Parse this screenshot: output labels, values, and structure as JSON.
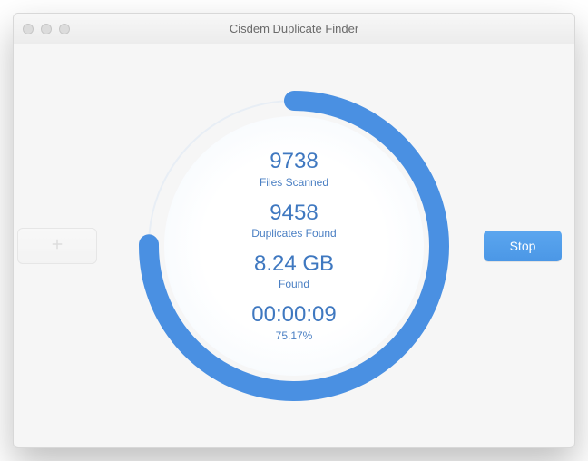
{
  "window": {
    "title": "Cisdem Duplicate Finder"
  },
  "scan": {
    "files_scanned_value": "9738",
    "files_scanned_label": "Files Scanned",
    "duplicates_found_value": "9458",
    "duplicates_found_label": "Duplicates Found",
    "size_found_value": "8.24 GB",
    "size_found_label": "Found",
    "elapsed_value": "00:00:09",
    "percent_label": "75.17%",
    "progress_fraction": 0.7517
  },
  "buttons": {
    "stop_label": "Stop"
  },
  "colors": {
    "accent": "#4a90e2",
    "text_blue": "#3f78c0"
  }
}
